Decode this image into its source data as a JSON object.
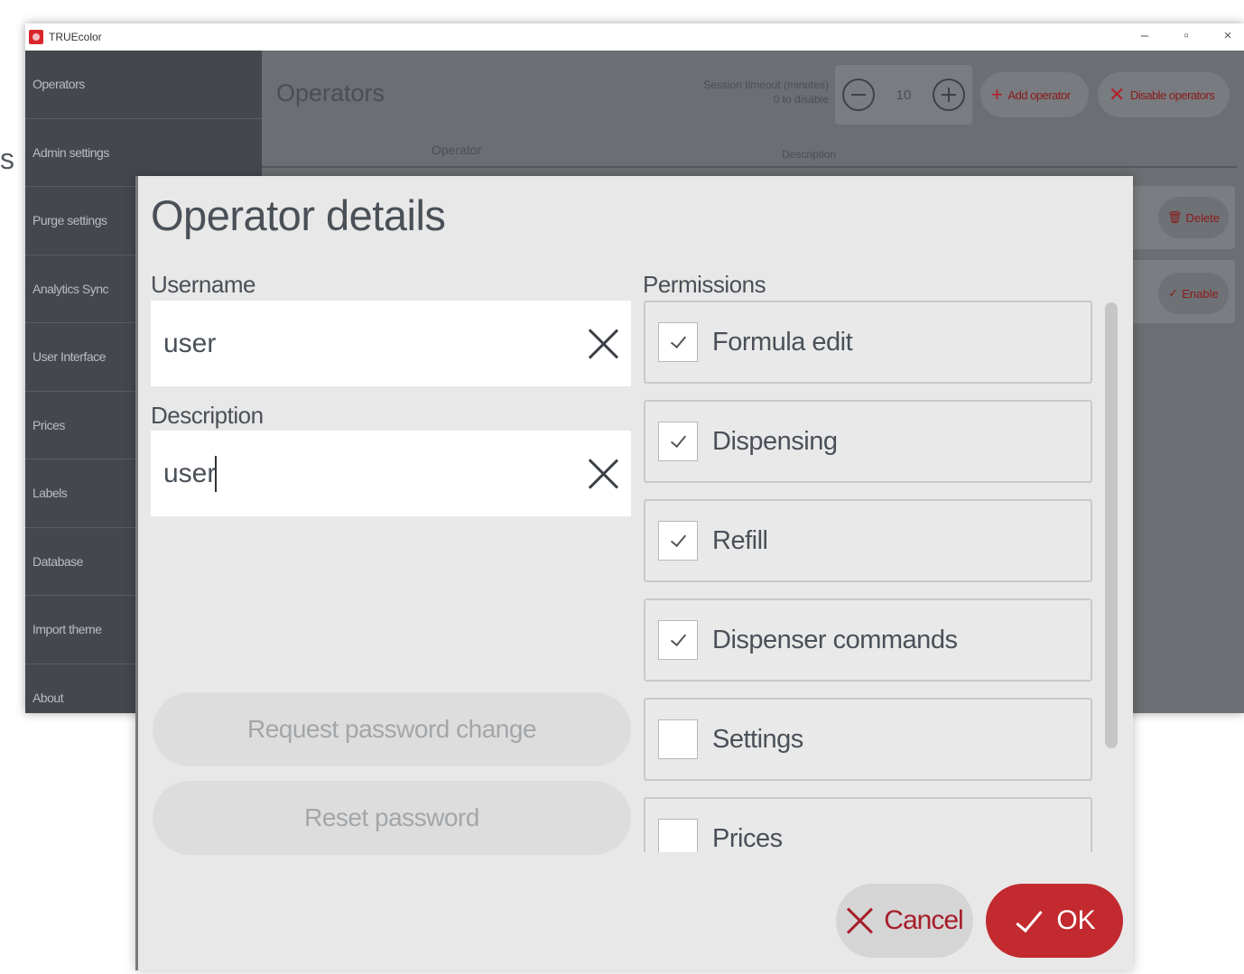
{
  "app": {
    "title": "TRUEcolor",
    "window_controls": [
      "–",
      "▫",
      "×"
    ]
  },
  "sidebar": {
    "items": [
      {
        "label": "Operators"
      },
      {
        "label": "Admin settings"
      },
      {
        "label": "Purge settings"
      },
      {
        "label": "Analytics Sync"
      },
      {
        "label": "User Interface"
      },
      {
        "label": "Prices"
      },
      {
        "label": "Labels"
      },
      {
        "label": "Database"
      },
      {
        "label": "Import theme"
      },
      {
        "label": "About"
      }
    ]
  },
  "background": {
    "title": "Operators",
    "timeout_label_1": "Session timeout (minutes)",
    "timeout_label_2": "0 to disable",
    "timeout_value": "10",
    "add_operator": "Add operator",
    "disable_operators": "Disable operators",
    "column_operator": "Operator",
    "column_description": "Description",
    "row_btn_delete": "Delete",
    "row_btn_enable": "Enable"
  },
  "stray_text": "s",
  "modal": {
    "title": "Operator details",
    "username_label": "Username",
    "username_value": "user",
    "description_label": "Description",
    "description_value": "user",
    "permissions_label": "Permissions",
    "request_password_change": "Request password change",
    "reset_password": "Reset password",
    "permissions": [
      {
        "label": "Formula edit",
        "checked": true
      },
      {
        "label": "Dispensing",
        "checked": true
      },
      {
        "label": "Refill",
        "checked": true
      },
      {
        "label": "Dispenser commands",
        "checked": true
      },
      {
        "label": "Settings",
        "checked": false
      },
      {
        "label": "Prices",
        "checked": false
      }
    ],
    "cancel_label": "Cancel",
    "ok_label": "OK"
  },
  "colors": {
    "accent": "#c22a2f",
    "cancel_text": "#a71d2a",
    "sidebar_bg": "#44484e"
  }
}
